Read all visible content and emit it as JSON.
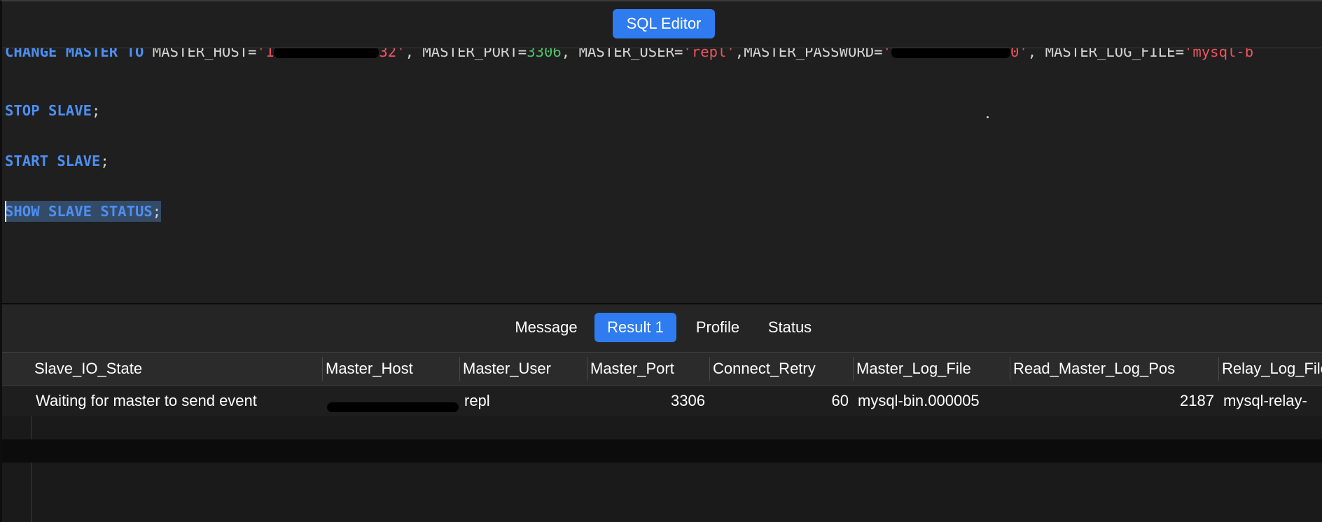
{
  "toolbar": {
    "title": "SQL Editor"
  },
  "editor": {
    "line1": {
      "kw": "CHANGE MASTER TO",
      "p1": " MASTER_HOST=",
      "host_start": "'1",
      "host_end": "32'",
      "p2": ", MASTER_PORT=",
      "port": "3306",
      "p3": ", MASTER_USER=",
      "user": "'repl'",
      "p4": ",MASTER_PASSWORD=",
      "pass_start": "'",
      "pass_end": "0'",
      "p5": ", MASTER_LOG_FILE=",
      "logfile": "'mysql-b"
    },
    "line2": {
      "kw": "STOP SLAVE",
      "end": ";"
    },
    "line3": {
      "kw": "START SLAVE",
      "end": ";"
    },
    "line4": {
      "kw": "SHOW SLAVE STATUS",
      "end": ";"
    }
  },
  "tabs": [
    {
      "label": "Message",
      "active": false
    },
    {
      "label": "Result 1",
      "active": true
    },
    {
      "label": "Profile",
      "active": false
    },
    {
      "label": "Status",
      "active": false
    }
  ],
  "grid": {
    "columns": [
      "Slave_IO_State",
      "Master_Host",
      "Master_User",
      "Master_Port",
      "Connect_Retry",
      "Master_Log_File",
      "Read_Master_Log_Pos",
      "Relay_Log_File"
    ],
    "rows": [
      [
        "Waiting for master to send event",
        "",
        "repl",
        "3306",
        "60",
        "mysql-bin.000005",
        "2187",
        "mysql-relay-"
      ]
    ]
  },
  "colors": {
    "accent": "#2e7cf0",
    "keyword": "#4d8ff2",
    "string": "#f0545e",
    "number": "#52c26a",
    "selection": "#344b68"
  }
}
